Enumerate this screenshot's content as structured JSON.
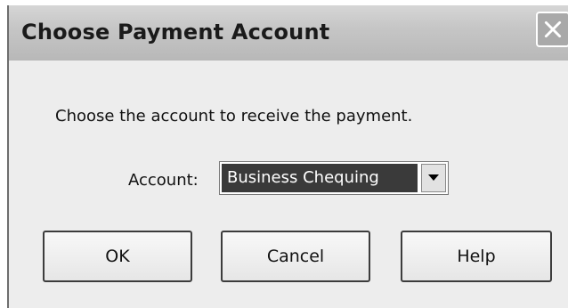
{
  "dialog": {
    "title": "Choose Payment Account",
    "close_icon": "close-icon"
  },
  "prompt": "Choose the account to receive the payment.",
  "account": {
    "label": "Account:",
    "selected": "Business Chequing",
    "dropdown_icon": "chevron-down-icon"
  },
  "buttons": {
    "ok": "OK",
    "cancel": "Cancel",
    "help": "Help"
  }
}
